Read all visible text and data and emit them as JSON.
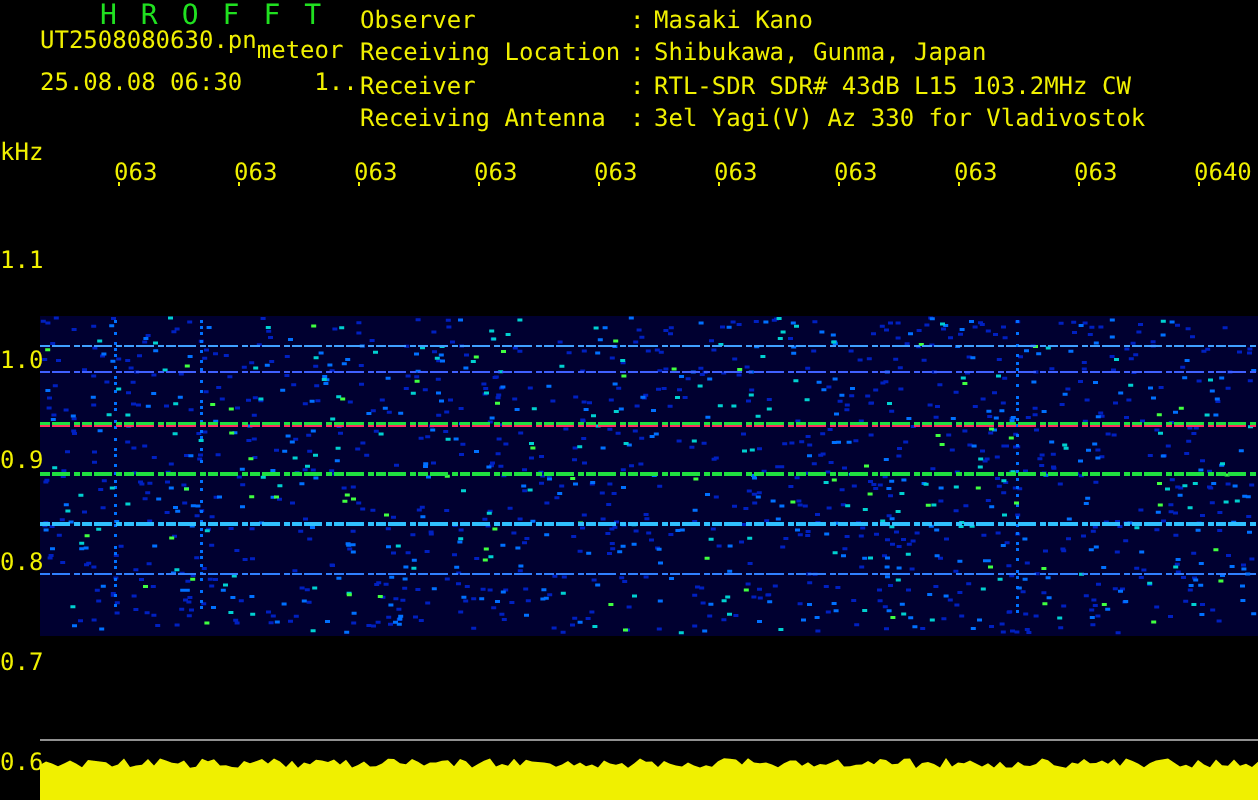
{
  "header": {
    "title": "HROFFT",
    "file": "UT2508080630.pn",
    "mode": "meteor",
    "timestamp": "25.08.08 06:30",
    "counter": "1..",
    "info": [
      {
        "label": "Observer",
        "separator": ":",
        "value": "Masaki Kano"
      },
      {
        "label": "Receiving Location",
        "separator": ":",
        "value": "Shibukawa, Gunma, Japan"
      },
      {
        "label": "Receiver",
        "separator": ":",
        "value": "RTL-SDR SDR# 43dB L15 103.2MHz CW"
      },
      {
        "label": "Receiving Antenna",
        "separator": ":",
        "value": "3el Yagi(V) Az 330 for Vladivostok"
      }
    ]
  },
  "plot": {
    "y_unit": "kHz",
    "y_labels": [
      "1.1",
      "1.0",
      "0.9",
      "0.8",
      "0.7",
      "0.6"
    ],
    "x_labels": [
      "063",
      "063",
      "063",
      "063",
      "063",
      "063",
      "063",
      "063",
      "063",
      "0640"
    ]
  }
}
